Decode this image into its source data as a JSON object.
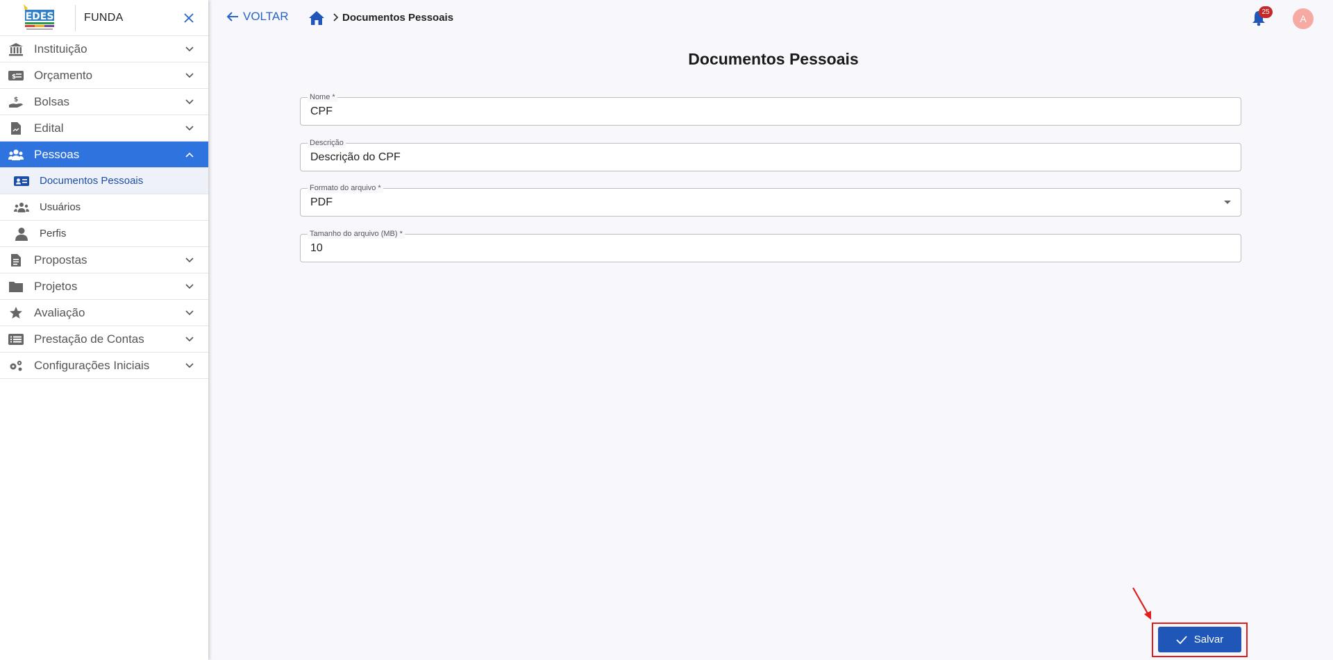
{
  "sidebar": {
    "brand": "FUNDA",
    "menu": [
      {
        "label": "Instituição",
        "icon": "bank-icon"
      },
      {
        "label": "Orçamento",
        "icon": "money-icon"
      },
      {
        "label": "Bolsas",
        "icon": "hand-coin-icon"
      },
      {
        "label": "Edital",
        "icon": "document-icon"
      },
      {
        "label": "Pessoas",
        "icon": "people-icon",
        "active": true
      }
    ],
    "sub_items": [
      {
        "label": "Documentos Pessoais",
        "icon": "id-card-icon",
        "selected": true
      },
      {
        "label": "Usuários",
        "icon": "users-icon"
      },
      {
        "label": "Perfis",
        "icon": "person-icon"
      }
    ],
    "menu_after": [
      {
        "label": "Propostas",
        "icon": "clipboard-icon"
      },
      {
        "label": "Projetos",
        "icon": "folder-icon"
      },
      {
        "label": "Avaliação",
        "icon": "star-icon"
      },
      {
        "label": "Prestação de Contas",
        "icon": "list-icon"
      },
      {
        "label": "Configurações Iniciais",
        "icon": "gears-icon"
      }
    ]
  },
  "topbar": {
    "back_label": "VOLTAR",
    "breadcrumb": "Documentos Pessoais",
    "notification_count": "25",
    "avatar_initial": "A"
  },
  "page": {
    "title": "Documentos Pessoais"
  },
  "form": {
    "nome": {
      "label": "Nome *",
      "value": "CPF"
    },
    "descricao": {
      "label": "Descrição",
      "value": "Descrição do CPF"
    },
    "formato": {
      "label": "Formato do arquivo *",
      "value": "PDF"
    },
    "tamanho": {
      "label": "Tamanho do arquivo (MB) *",
      "value": "10"
    }
  },
  "actions": {
    "save_label": "Salvar"
  },
  "colors": {
    "accent": "#2e73de",
    "primary_button": "#1f56b8",
    "annotation": "#e11d1d"
  }
}
